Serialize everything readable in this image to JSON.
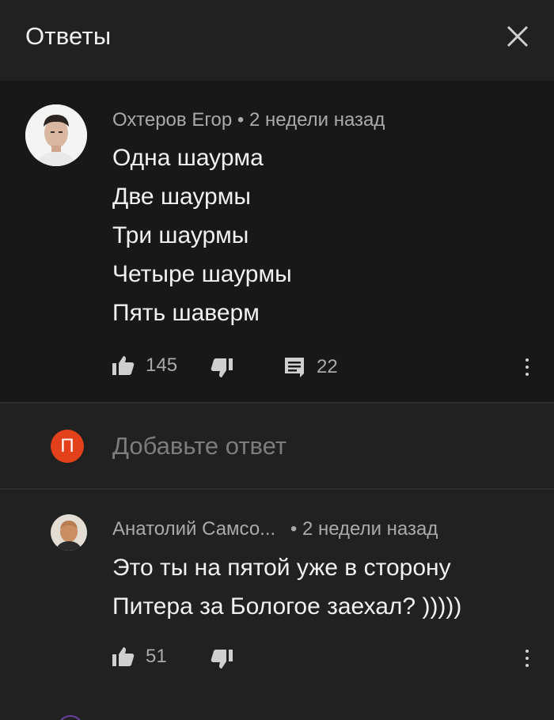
{
  "header": {
    "title": "Ответы"
  },
  "comments": [
    {
      "author": "Охтеров Егор",
      "time": "2 недели назад",
      "lines": [
        "Одна шаурма",
        "Две шаурмы",
        "Три шаурмы",
        "Четыре шаурмы",
        "Пять шаверм"
      ],
      "likes": "145",
      "replies": "22"
    },
    {
      "author": "Анатолий Самсо...",
      "time": "2 недели назад",
      "lines": [
        "Это ты на пятой уже в сторону",
        "Питера за Бологое заехал? )))))"
      ],
      "likes": "51"
    }
  ],
  "reply_box": {
    "avatar_letter": "П",
    "placeholder": "Добавьте ответ"
  },
  "separator": "•",
  "colors": {
    "background": "#212121",
    "comment_bg": "#181818",
    "avatar_red": "#e2411c",
    "notification_dot": "#e53935"
  },
  "icons": [
    "close-icon",
    "thumb-up-icon",
    "thumb-down-icon",
    "reply-icon",
    "more-vert-icon"
  ]
}
